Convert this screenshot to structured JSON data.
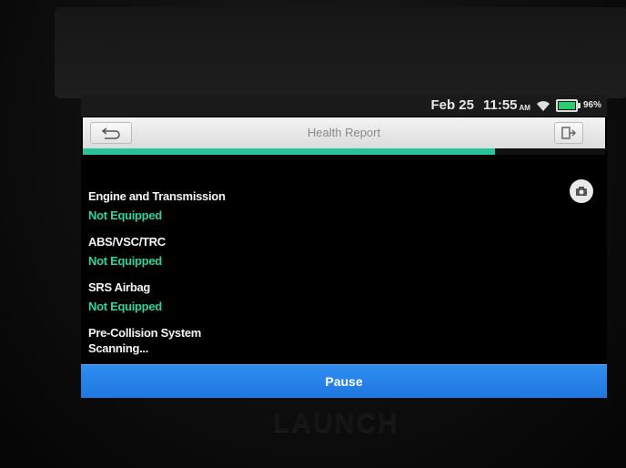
{
  "status_bar": {
    "date": "Feb 25",
    "time": "11:55",
    "ampm": "AM",
    "battery_percent": "96%",
    "wifi_icon": "wifi-icon",
    "battery_icon": "battery-icon"
  },
  "header": {
    "title": "Health Report",
    "back_icon": "back-arrow-icon",
    "exit_icon": "exit-icon"
  },
  "progress": {
    "fraction": 0.79,
    "color": "#28c39a"
  },
  "camera_icon": "camera-icon",
  "systems": [
    {
      "name": "Engine and Transmission",
      "status": "Not Equipped"
    },
    {
      "name": "ABS/VSC/TRC",
      "status": "Not Equipped"
    },
    {
      "name": "SRS Airbag",
      "status": "Not Equipped"
    },
    {
      "name": "Pre-Collision System",
      "status": "Scanning..."
    }
  ],
  "actions": {
    "pause_label": "Pause"
  },
  "brand": "LAUNCH",
  "colors": {
    "accent": "#28c39a",
    "button": "#2f8eef"
  }
}
